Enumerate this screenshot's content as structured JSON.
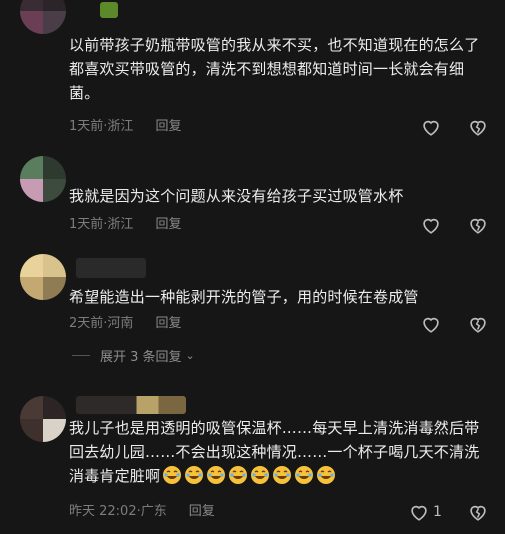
{
  "comments": [
    {
      "text": "以前带孩子奶瓶带吸管的我从来不买，也不知道现在的怎么了都喜欢买带吸管的，清洗不到想想都知道时间一长就会有细菌。",
      "time": "1天前",
      "location": "浙江",
      "reply_label": "回复"
    },
    {
      "text": "我就是因为这个问题从来没有给孩子买过吸管水杯",
      "time": "1天前",
      "location": "浙江",
      "reply_label": "回复"
    },
    {
      "text": "希望能造出一种能剥开洗的管子，用的时候在卷成管",
      "time": "2天前",
      "location": "河南",
      "reply_label": "回复"
    },
    {
      "text": "我儿子也是用透明的吸管保温杯……每天早上清洗消毒然后带回去幼儿园……不会出现这种情况……一个杯子喝几天不清洗消毒肯定脏啊",
      "time": "昨天 22:02",
      "location": "广东",
      "reply_label": "回复",
      "like_count": "1"
    }
  ],
  "expand_replies_label": "展开 3 条回复",
  "separator": " · ",
  "icons": {
    "like": "heart-outline-icon",
    "dislike": "broken-heart-icon",
    "expand": "chevron-down-icon",
    "emoji": "rolling-laughing-emoji"
  },
  "colors": {
    "background": "#161616",
    "text": "#ececec",
    "meta": "#7d7d7d"
  }
}
